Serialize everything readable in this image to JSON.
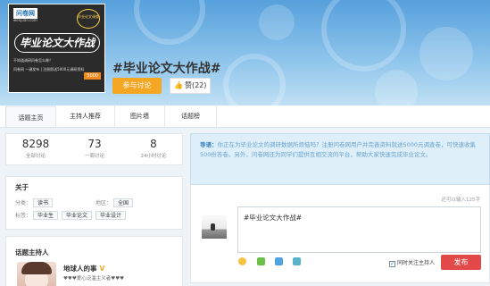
{
  "cover": {
    "brand": "问卷网",
    "brand_sub": "wenjuan.com",
    "title": "毕业论文大作战",
    "badge": "毕业论文调查",
    "line1": "不知道调研问卷怎么做？",
    "line2": "问卷网 一键发布 | 注册即送5000元调研资料",
    "price": "5000"
  },
  "topic": {
    "title": "#毕业论文大作战#",
    "join_label": "参与讨论",
    "like_label": "赞(22)"
  },
  "tabs": [
    "话题主页",
    "主持人推荐",
    "图片墙",
    "话题榜"
  ],
  "stats": [
    {
      "num": "8298",
      "label": "全部讨论"
    },
    {
      "num": "73",
      "label": "一周讨论"
    },
    {
      "num": "8",
      "label": "24小时讨论"
    }
  ],
  "about": {
    "title": "关于",
    "category_label": "分类：",
    "category": "读书",
    "region_label": "地区：",
    "region": "全国",
    "tags_label": "标签：",
    "tags": [
      "毕业生",
      "毕业论文",
      "毕业设计"
    ]
  },
  "host": {
    "title": "话题主持人",
    "name": "地球人的事",
    "verified": "V",
    "desc": "♥♥♥爱心泛滥主义者♥♥♥"
  },
  "guide": {
    "label": "导语：",
    "text": "你正在为毕业论文的调研数据所烦恼吗？注册问卷网用户并完善资料就送5000元调查卷，可快速收集500份答卷。另外，问卷网还为同学们提供互相交流的平台，帮助大家快速完成毕业论文。"
  },
  "composer": {
    "char_hint": "还可以输入125字",
    "content": "#毕业论文大作战#",
    "follow_label": "同时关注主持人",
    "post_label": "发布"
  },
  "colors": {
    "accent_orange": "#f5a623",
    "post_red": "#e44949",
    "link_blue": "#2f7dbd"
  }
}
